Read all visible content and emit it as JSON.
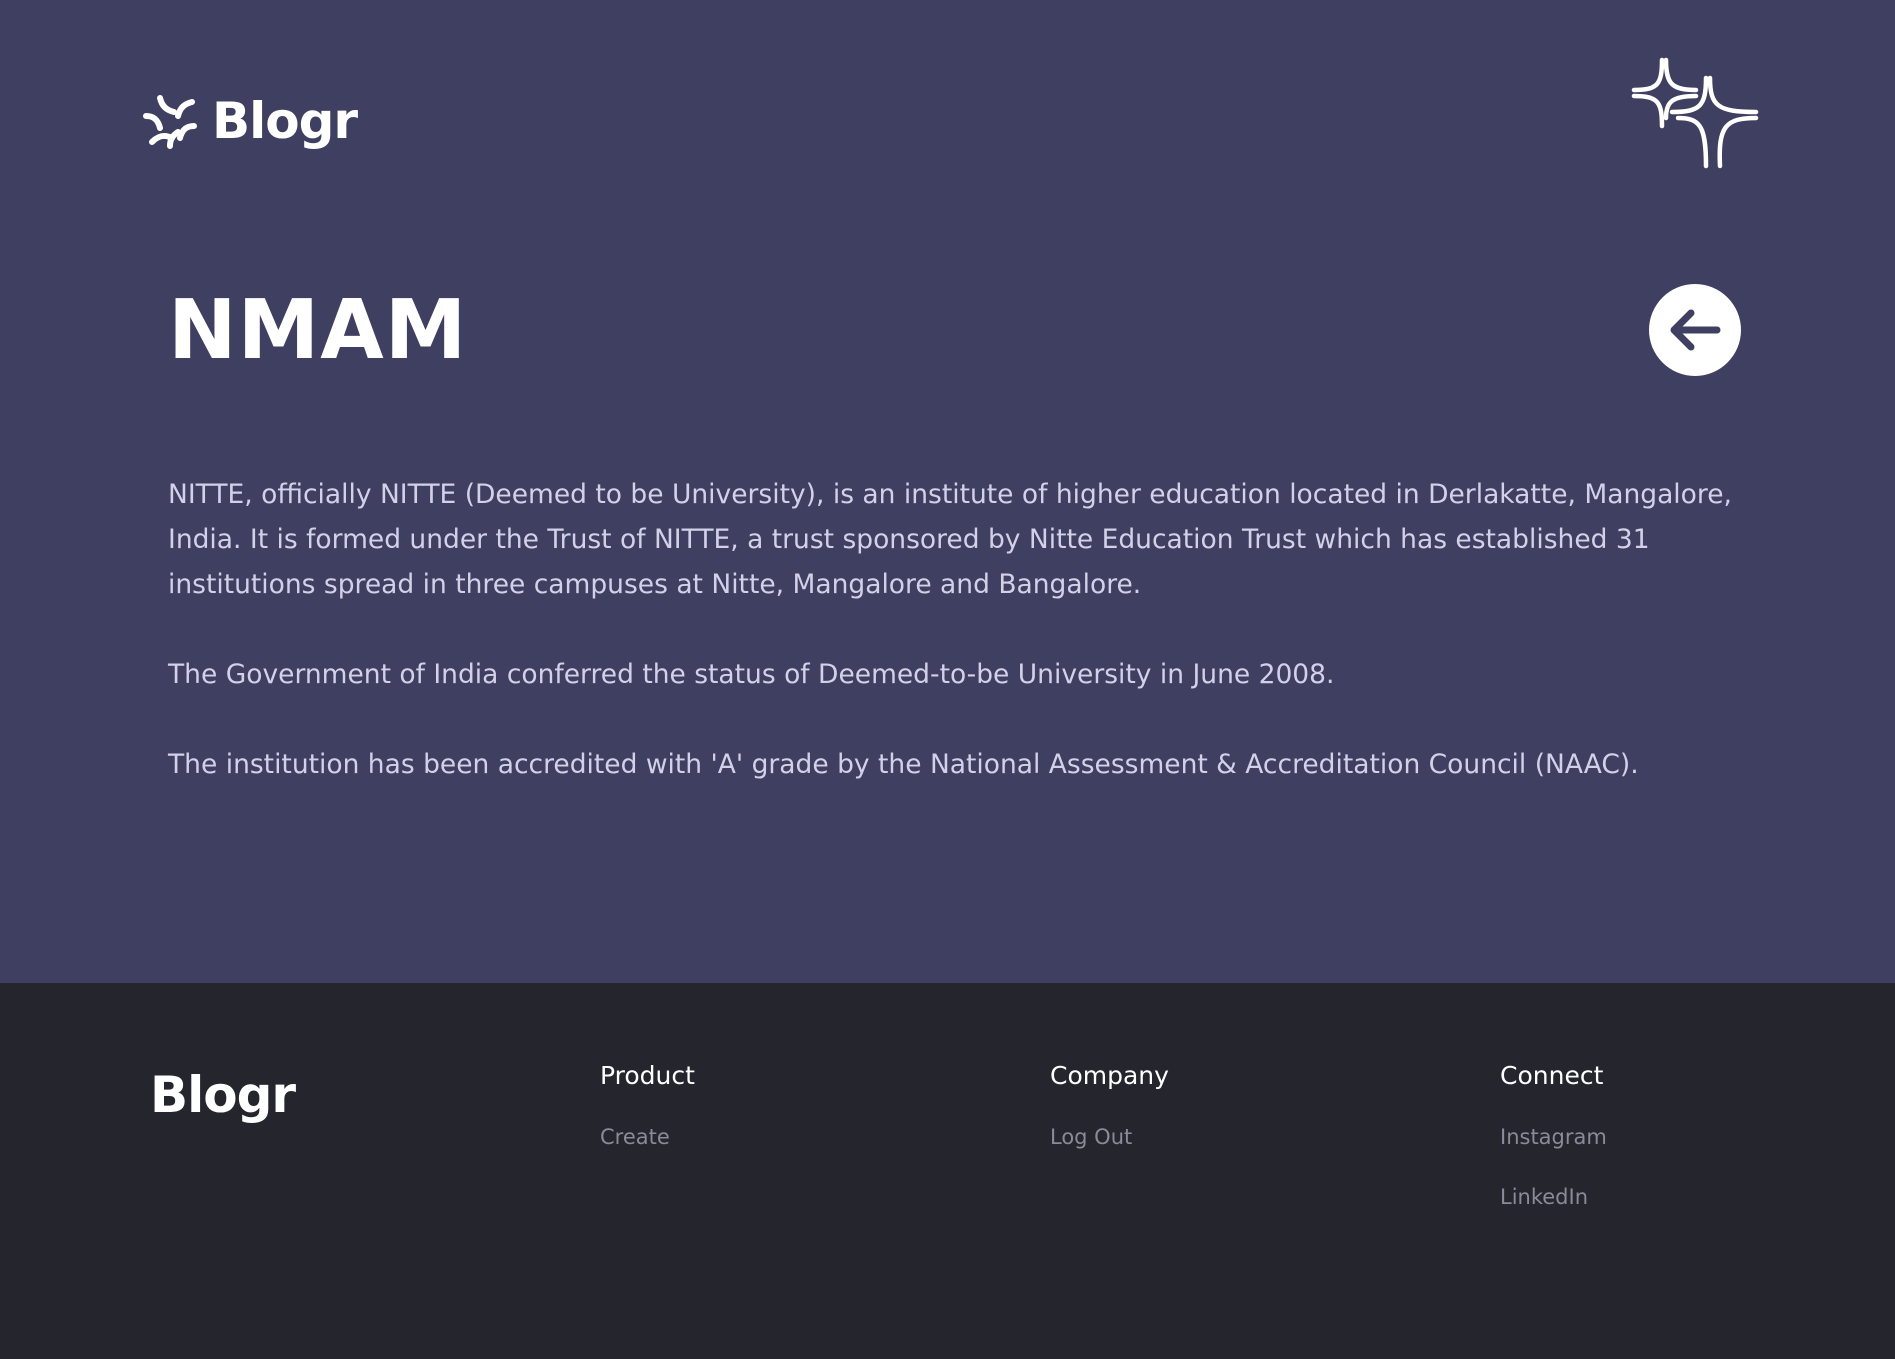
{
  "brand": {
    "name": "Blogr"
  },
  "header": {
    "menu_icon": "sparkle-burst-icon"
  },
  "main": {
    "title": "NMAM",
    "back_icon": "arrow-left-icon",
    "paragraphs": [
      "NITTE, officially NITTE (Deemed to be University), is an institute of higher education located in Derlakatte, Mangalore, India. It is formed under the Trust of NITTE, a trust sponsored by Nitte Education Trust which has established 31 institutions spread in three campuses at Nitte, Mangalore and Bangalore.",
      "The Government of India conferred the status of Deemed-to-be University in June 2008.",
      "The institution has been accredited with 'A' grade by the National Assessment & Accreditation Council (NAAC)."
    ]
  },
  "footer": {
    "logo": "Blogr",
    "columns": [
      {
        "heading": "Product",
        "links": [
          "Create"
        ]
      },
      {
        "heading": "Company",
        "links": [
          "Log Out"
        ]
      },
      {
        "heading": "Connect",
        "links": [
          "Instagram",
          "LinkedIn"
        ]
      }
    ]
  },
  "colors": {
    "hero_bg": "#3f3f61",
    "footer_bg": "#25252e",
    "text_primary": "#ffffff",
    "text_body": "#d2d1e8",
    "text_muted": "#8a8a98"
  }
}
